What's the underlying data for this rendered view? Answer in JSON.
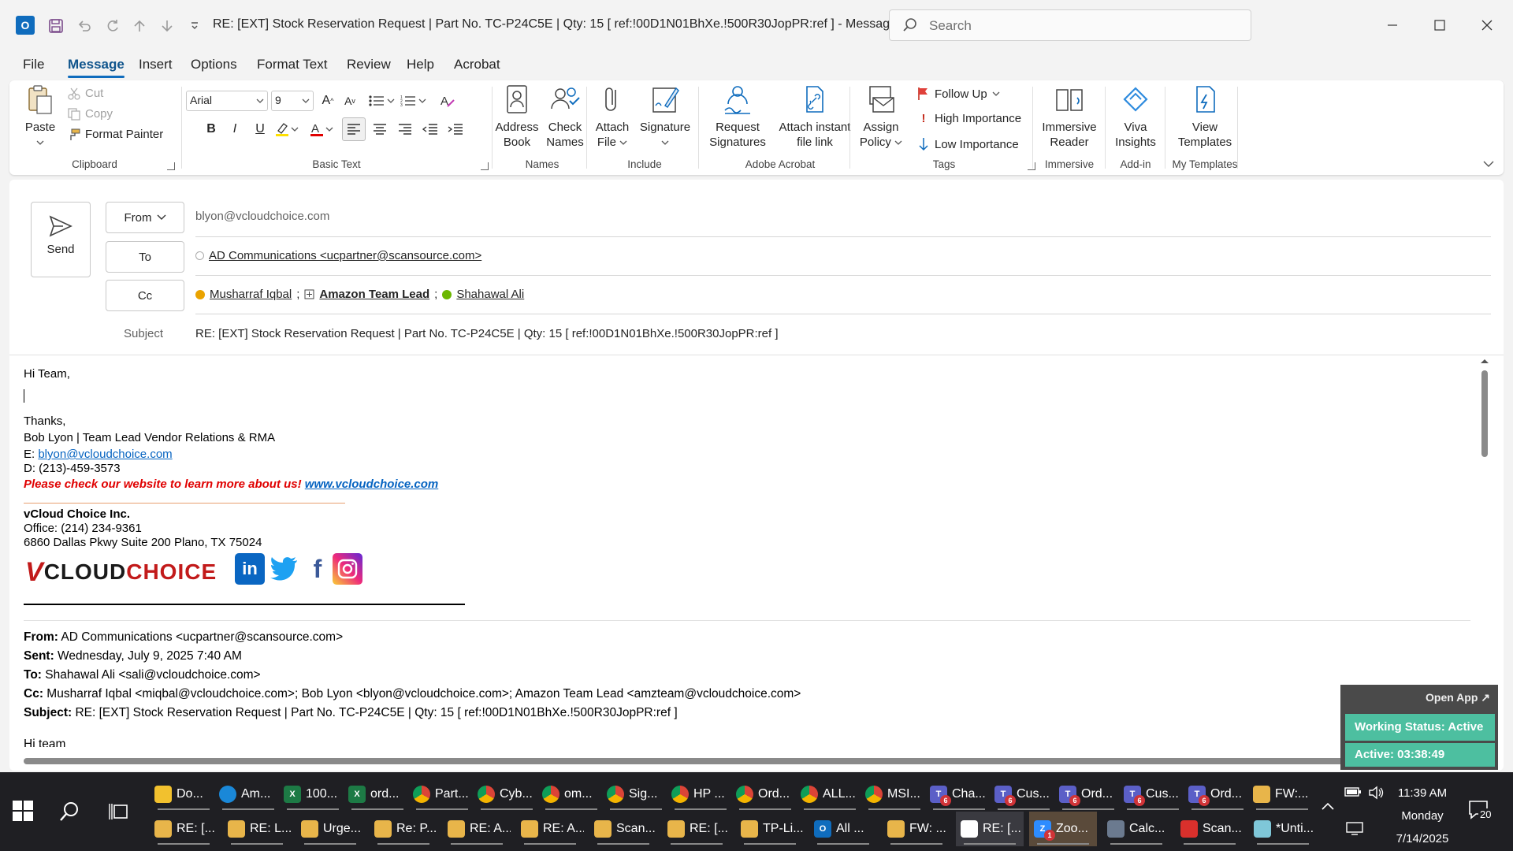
{
  "window": {
    "title": "RE: [EXT] Stock Reservation Request | Part No. TC-P24C5E | Qty: 15    [ ref:!00D1N01BhXe.!500R30JopPR:ref ]  -  Message (HT...",
    "search_placeholder": "Search"
  },
  "menu": {
    "tabs": [
      {
        "label": "File"
      },
      {
        "label": "Message"
      },
      {
        "label": "Insert"
      },
      {
        "label": "Options"
      },
      {
        "label": "Format Text"
      },
      {
        "label": "Review"
      },
      {
        "label": "Help"
      },
      {
        "label": "Acrobat"
      }
    ],
    "active": "Message"
  },
  "ribbon": {
    "clipboard": {
      "paste": "Paste",
      "cut": "Cut",
      "copy": "Copy",
      "format_painter": "Format Painter",
      "label": "Clipboard"
    },
    "basic_text": {
      "font": "Arial",
      "size": "9",
      "label": "Basic Text"
    },
    "names": {
      "address_book_1": "Address",
      "address_book_2": "Book",
      "check_names_1": "Check",
      "check_names_2": "Names",
      "label": "Names"
    },
    "include": {
      "attach_1": "Attach",
      "attach_2": "File",
      "signature": "Signature",
      "label": "Include"
    },
    "adobe": {
      "request_1": "Request",
      "request_2": "Signatures",
      "attach_link_1": "Attach instant",
      "attach_link_2": "file link",
      "label": "Adobe Acrobat"
    },
    "tags": {
      "assign_1": "Assign",
      "assign_2": "Policy",
      "follow_up": "Follow Up",
      "high": "High Importance",
      "low": "Low Importance",
      "label": "Tags"
    },
    "immersive": {
      "btn_1": "Immersive",
      "btn_2": "Reader",
      "label": "Immersive"
    },
    "addin": {
      "btn_1": "Viva",
      "btn_2": "Insights",
      "label": "Add-in"
    },
    "templates": {
      "btn_1": "View",
      "btn_2": "Templates",
      "label": "My Templates"
    }
  },
  "compose": {
    "send": "Send",
    "from_label": "From",
    "from_value": "blyon@vcloudchoice.com",
    "to_label": "To",
    "to_value": "AD Communications <ucpartner@scansource.com>",
    "cc_label": "Cc",
    "cc_1": "Musharraf Iqbal",
    "cc_2": "Amazon Team Lead",
    "cc_3": "Shahawal Ali",
    "subject_label": "Subject",
    "subject_value": "RE: [EXT] Stock Reservation Request | Part No. TC-P24C5E | Qty: 15    [ ref:!00D1N01BhXe.!500R30JopPR:ref ]"
  },
  "body": {
    "greeting": "Hi Team,",
    "thanks": "Thanks,",
    "sig_name": "Bob Lyon | Team Lead Vendor Relations & RMA",
    "email_label": "E: ",
    "email": "blyon@vcloudchoice.com",
    "phone": "D: (213)-459-3573",
    "promo_text": "Please check our website to learn more about us! ",
    "promo_link": "www.vcloudchoice.com",
    "company": "vCloud Choice Inc.",
    "office": "Office: (214) 234-9361",
    "address": "6860 Dallas Pkwy Suite 200 Plano, TX 75024",
    "logo_v": "V",
    "logo_cloud": "CLOUD",
    "logo_choice": "CHOICE",
    "social": {
      "linkedin": "in",
      "facebook": "f"
    }
  },
  "quoted": {
    "from_label": "From:",
    "from": " AD Communications <ucpartner@scansource.com>",
    "sent_label": "Sent:",
    "sent": " Wednesday, July 9, 2025 7:40 AM",
    "to_label": "To:",
    "to": " Shahawal Ali <sali@vcloudchoice.com>",
    "cc_label": "Cc:",
    "cc": " Musharraf Iqbal <miqbal@vcloudchoice.com>; Bob Lyon <blyon@vcloudchoice.com>; Amazon Team Lead <amzteam@vcloudchoice.com>",
    "subject_label": "Subject:",
    "subject": " RE: [EXT] Stock Reservation Request | Part No. TC-P24C5E | Qty: 15 [ ref:!00D1N01BhXe.!500R30JopPR:ref ]",
    "next": "Hi team"
  },
  "status_widget": {
    "open_app": "Open App ↗",
    "working": "Working Status: Active",
    "active": "Active: 03:38:49"
  },
  "taskbar": {
    "row1": [
      {
        "label": "Do...",
        "icon": "folder-icon",
        "color": "#f2c12e"
      },
      {
        "label": "Am...",
        "icon": "edge-icon",
        "color": "#1a88d8"
      },
      {
        "label": "100...",
        "icon": "excel-icon",
        "color": "#1d7a45",
        "glyph": "X"
      },
      {
        "label": "ord...",
        "icon": "excel-icon",
        "color": "#1d7a45",
        "glyph": "X"
      },
      {
        "label": "Part...",
        "icon": "chrome-icon",
        "color": "#db4437"
      },
      {
        "label": "Cyb...",
        "icon": "chrome-icon",
        "color": "#db4437"
      },
      {
        "label": "om...",
        "icon": "chrome-icon",
        "color": "#db4437"
      },
      {
        "label": "Sig...",
        "icon": "chrome-icon",
        "color": "#db4437"
      },
      {
        "label": "HP ...",
        "icon": "chrome-icon",
        "color": "#db4437"
      },
      {
        "label": "Ord...",
        "icon": "chrome-icon",
        "color": "#db4437"
      },
      {
        "label": "ALL...",
        "icon": "chrome-icon",
        "color": "#db4437"
      },
      {
        "label": "MSI...",
        "icon": "chrome-icon",
        "color": "#db4437"
      },
      {
        "label": "Cha...",
        "icon": "teams-icon",
        "color": "#5b5fc7",
        "glyph": "T",
        "badge": "6"
      },
      {
        "label": "Cus...",
        "icon": "teams-icon",
        "color": "#5b5fc7",
        "glyph": "T",
        "badge": "6"
      },
      {
        "label": "Ord...",
        "icon": "teams-icon",
        "color": "#5b5fc7",
        "glyph": "T",
        "badge": "6"
      },
      {
        "label": "Cus...",
        "icon": "teams-icon",
        "color": "#5b5fc7",
        "glyph": "T",
        "badge": "6"
      },
      {
        "label": "Ord...",
        "icon": "teams-icon",
        "color": "#5b5fc7",
        "glyph": "T",
        "badge": "6"
      },
      {
        "label": "FW:...",
        "icon": "mail-icon",
        "color": "#e8b54a"
      }
    ],
    "row2": [
      {
        "label": "RE: [...",
        "icon": "mail-icon",
        "color": "#e8b54a"
      },
      {
        "label": "RE: L...",
        "icon": "mail-icon",
        "color": "#e8b54a"
      },
      {
        "label": "Urge...",
        "icon": "mail-icon",
        "color": "#e8b54a"
      },
      {
        "label": "Re: P...",
        "icon": "mail-icon",
        "color": "#e8b54a"
      },
      {
        "label": "RE: A...",
        "icon": "mail-icon",
        "color": "#e8b54a"
      },
      {
        "label": "RE: A...",
        "icon": "mail-icon",
        "color": "#e8b54a"
      },
      {
        "label": "Scan...",
        "icon": "mail-icon",
        "color": "#e8b54a"
      },
      {
        "label": "RE: [...",
        "icon": "mail-icon",
        "color": "#e8b54a"
      },
      {
        "label": "TP-Li...",
        "icon": "mail-icon",
        "color": "#e8b54a"
      },
      {
        "label": "All ...",
        "icon": "outlook-icon",
        "color": "#0f6cbd",
        "glyph": "O"
      },
      {
        "label": "FW: ...",
        "icon": "mail-icon",
        "color": "#e8b54a"
      },
      {
        "label": "RE: [...",
        "icon": "mail-icon",
        "color": "#ffffff",
        "active": true
      },
      {
        "label": "Zoo...",
        "icon": "zoom-icon",
        "color": "#2d8cff",
        "glyph": "Z",
        "badge": "1",
        "highlight": true
      },
      {
        "label": "Calc...",
        "icon": "calculator-icon",
        "color": "#6b7a8f"
      },
      {
        "label": "Scan...",
        "icon": "pdf-icon",
        "color": "#d9302c"
      },
      {
        "label": "*Unti...",
        "icon": "notepad-icon",
        "color": "#7fc7d8"
      }
    ],
    "time": "11:39 AM",
    "day": "Monday",
    "date": "7/14/2025",
    "notifications": "20"
  }
}
